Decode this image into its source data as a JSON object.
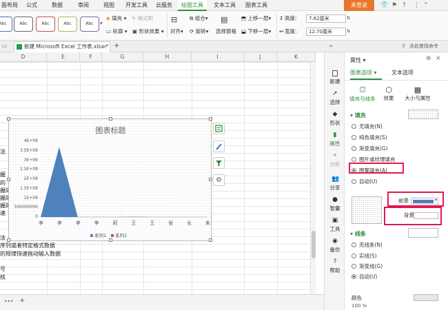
{
  "menubar": {
    "items": [
      "面布局",
      "公式",
      "数据",
      "审阅",
      "视图",
      "开发工具",
      "云服务",
      "绘图工具",
      "文本工具",
      "图表工具"
    ],
    "active_index": 7,
    "login": "未登录"
  },
  "ribbon": {
    "styles": [
      "Abc",
      "Abc",
      "Abc",
      "Abc",
      "Abc"
    ],
    "fill": "填充",
    "format_brush": "格式刷",
    "outline": "轮廓",
    "shape_effect": "形状效果",
    "align": "对齐",
    "combine": "组合",
    "rotate": "旋转",
    "selection_pane": "选择窗格",
    "bring_forward": "上移一层",
    "send_backward": "下移一层",
    "height_label": "高度:",
    "height_value": "7.62厘米",
    "width_label": "宽度:",
    "width_value": "12.70厘米"
  },
  "tabbar": {
    "doc_tab": "新建 Microsoft Excel 工作表.xlsx *",
    "new_tab": "+",
    "search_hint": "点此查找命令"
  },
  "sheet": {
    "columns": [
      "D",
      "E",
      "F",
      "G",
      "H",
      "I",
      "J",
      "K"
    ],
    "fragments": {
      "r1": "法",
      "r2a": "握",
      "r2b": "的",
      "r2c": "握的",
      "r2d": "握的",
      "r2e": "握的",
      "r2f": "速",
      "r3": "法",
      "r4": "序列或者特定格式数据",
      "r5": "的规律快速拖动输入数据",
      "r6": "号",
      "r7": "核"
    }
  },
  "chart_data": {
    "type": "area",
    "title": "图表标题",
    "categories": [
      "李",
      "李",
      "李",
      "李",
      "莉",
      "王",
      "王",
      "张",
      "长",
      "朱"
    ],
    "yticks": [
      "4E+09",
      "3.5E+09",
      "3E+09",
      "2.5E+09",
      "2E+09",
      "1.5E+09",
      "1E+09",
      "500000000",
      "0"
    ],
    "ylim": [
      0,
      4000000000
    ],
    "series": [
      {
        "name": "系列1",
        "color": "#4f81bd",
        "values": [
          0,
          3700000000,
          0,
          0,
          0,
          20000000,
          0,
          0,
          0,
          0
        ]
      },
      {
        "name": "系列2",
        "color": "#c0504d",
        "values": [
          0,
          0,
          0,
          0,
          0,
          0,
          0,
          0,
          0,
          0
        ]
      }
    ]
  },
  "rail": {
    "items": [
      "新建",
      "选择",
      "形状",
      "属性",
      "分析",
      "分享",
      "智囊",
      "工具",
      "备份",
      "帮助"
    ],
    "active_index": 3,
    "disabled_index": 4
  },
  "panel": {
    "title": "属性",
    "tab_chart_options": "图表选项",
    "tab_text_options": "文本选项",
    "subtab_fill_line": "填充与线条",
    "subtab_effects": "效果",
    "subtab_size": "大小与属性",
    "fill_section": "填充",
    "fill_options": [
      "无填充(N)",
      "纯色填充(S)",
      "渐变填充(G)",
      "图片或纹理填充",
      "图案填充(A)",
      "自动(U)"
    ],
    "fill_checked": 4,
    "foreground_label": "前景",
    "foreground_color": "#4f81bd",
    "background_label": "背景",
    "line_section": "线条",
    "line_options": [
      "无线条(N)",
      "实线(S)",
      "渐变线(G)",
      "自动(U)"
    ],
    "line_checked": 3,
    "color_label": "颜色"
  },
  "status": {
    "zoom": "100 %"
  }
}
